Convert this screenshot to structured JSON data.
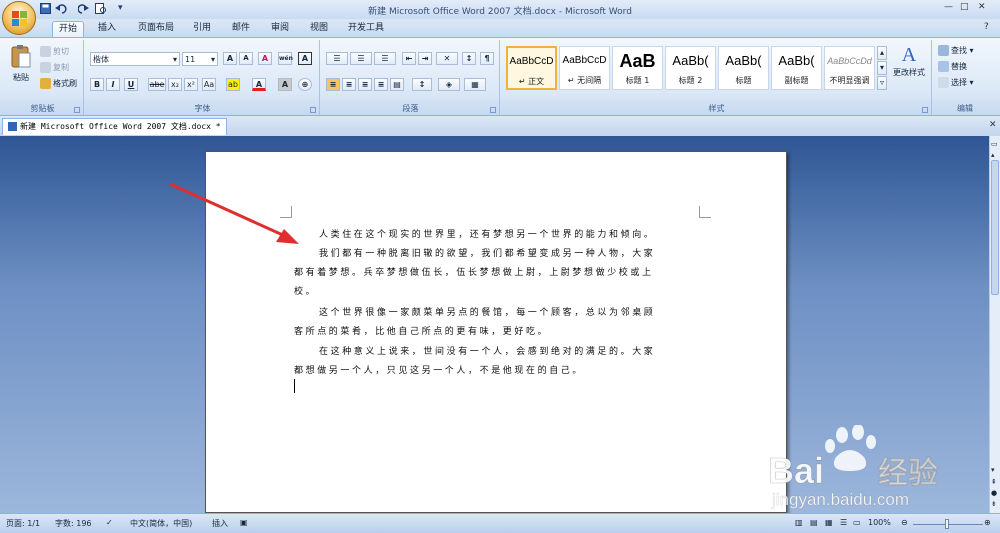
{
  "window": {
    "title": "新建 Microsoft Office Word 2007 文档.docx - Microsoft Word"
  },
  "quick_access": {
    "save_icon": "save-icon",
    "undo_icon": "undo-icon",
    "redo_icon": "redo-icon",
    "preview_icon": "print-preview-icon"
  },
  "tabs": [
    "开始",
    "插入",
    "页面布局",
    "引用",
    "邮件",
    "审阅",
    "视图",
    "开发工具"
  ],
  "clipboard": {
    "paste": "粘贴",
    "cut": "剪切",
    "copy": "复制",
    "format_painter": "格式刷",
    "label": "剪贴板"
  },
  "font": {
    "name": "楷体",
    "size": "11",
    "bold": "B",
    "italic": "I",
    "underline": "U",
    "strike": "abe",
    "sub": "x₂",
    "sup": "x²",
    "change_case": "Aa",
    "highlight": "ab",
    "color": "A",
    "border": "A",
    "grow": "A",
    "shrink": "A",
    "clear": "A",
    "phonetic": "wén",
    "label": "字体"
  },
  "paragraph": {
    "label": "段落"
  },
  "styles": {
    "items": [
      {
        "preview": "AaBbCcD",
        "name": "↵ 正文"
      },
      {
        "preview": "AaBbCcD",
        "name": "↵ 无间隔"
      },
      {
        "preview": "AaB",
        "name": "标题 1"
      },
      {
        "preview": "AaBb(",
        "name": "标题 2"
      },
      {
        "preview": "AaBb(",
        "name": "标题"
      },
      {
        "preview": "AaBb(",
        "name": "副标题"
      },
      {
        "preview": "AaBbCcDd",
        "name": "不明显强调"
      }
    ],
    "change_styles": "更改样式",
    "label": "样式"
  },
  "editing": {
    "find": "查找",
    "replace": "替换",
    "select": "选择",
    "label": "编辑"
  },
  "document_tab": "新建 Microsoft Office Word 2007 文档.docx *",
  "document": {
    "lines": [
      "人类住在这个现实的世界里，还有梦想另一个世界的能力和倾向。",
      "我们都有一种脱离旧辙的欲望，我们都希望变成另一种人物，大家",
      "都有着梦想。兵卒梦想做伍长，伍长梦想做上尉，上尉梦想做少校或上",
      "校。",
      "这个世界很像一家颇菜单另点的餐馆，每一个顾客，总以为邻桌顾",
      "客所点的菜肴，比他自己所点的更有味，更好吃。",
      "在这种意义上说来，世间没有一个人，会感到绝对的满足的。大家",
      "都想做另一个人，只见这另一个人，不是他现在的自己。"
    ]
  },
  "status": {
    "page": "页面: 1/1",
    "words": "字数: 196",
    "language": "中文(简体，中国)",
    "insert": "插入",
    "zoom": "100%"
  },
  "watermark": {
    "brand": "Bai",
    "brand_cn": "经验",
    "url": "jingyan.baidu.com"
  },
  "colors": {
    "accent": "#c9daf0",
    "arrow": "#e02e2e",
    "workspace": "#4a6fa8"
  }
}
